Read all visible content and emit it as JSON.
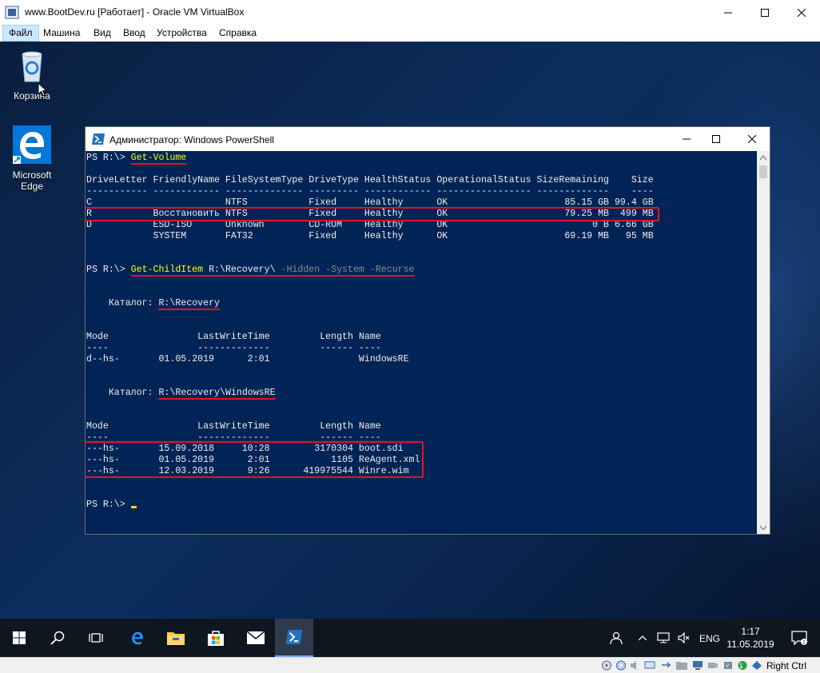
{
  "host": {
    "title": "www.BootDev.ru [Работает] - Oracle VM VirtualBox",
    "menu": [
      "Файл",
      "Машина",
      "Вид",
      "Ввод",
      "Устройства",
      "Справка"
    ],
    "host_key": "Right Ctrl"
  },
  "desktop": {
    "icons": [
      {
        "label": "Корзина",
        "icon": "recycle-bin-icon"
      },
      {
        "label": "Microsoft Edge",
        "icon": "edge-icon"
      }
    ]
  },
  "powershell": {
    "title": "Администратор: Windows PowerShell",
    "prompt1": {
      "prompt": "PS R:\\> ",
      "command": "Get-Volume"
    },
    "volume_header": "DriveLetter FriendlyName FileSystemType DriveType HealthStatus OperationalStatus SizeRemaining    Size",
    "volume_sep": "----------- ------------ -------------- --------- ------------ ----------------- -------------    ----",
    "volume_rows": [
      "C                        NTFS           Fixed     Healthy      OK                     85.15 GB 99.4 GB",
      "R           Восстановить NTFS           Fixed     Healthy      OK                     79.25 MB  499 MB",
      "D           ESD-ISO      Unknown        CD-ROM    Healthy      OK                          0 B 6.66 GB",
      "            SYSTEM       FAT32          Fixed     Healthy      OK                     69.19 MB   95 MB"
    ],
    "prompt2": {
      "prompt": "PS R:\\> ",
      "command": "Get-ChildItem",
      "arg": " R:\\Recovery\\ ",
      "params": "-Hidden -System -Recurse"
    },
    "dir1": {
      "label": "    Каталог: ",
      "path": "R:\\Recovery"
    },
    "dir_header": "Mode                LastWriteTime         Length Name",
    "dir_sep": "----                -------------         ------ ----",
    "dir1_rows": [
      "d--hs-       01.05.2019      2:01                WindowsRE"
    ],
    "dir2": {
      "label": "    Каталог: ",
      "path": "R:\\Recovery\\WindowsRE"
    },
    "dir2_rows": [
      "---hs-       15.09.2018     10:28        3170304 boot.sdi",
      "---hs-       01.05.2019      2:01           1105 ReAgent.xml",
      "---hs-       12.03.2019      9:26      419975544 Winre.wim"
    ],
    "prompt3": "PS R:\\> "
  },
  "taskbar": {
    "buttons": [
      "start-icon",
      "search-icon",
      "task-view-icon",
      "edge-icon",
      "file-explorer-icon",
      "store-icon",
      "mail-icon",
      "powershell-icon"
    ],
    "language": "ENG",
    "time": "1:17",
    "date": "11.05.2019"
  },
  "colors": {
    "console_bg": "#012456",
    "console_fg": "#eeedf0",
    "command": "#ffff00",
    "parameter": "#8a8a8a",
    "highlight": "#e81123"
  }
}
